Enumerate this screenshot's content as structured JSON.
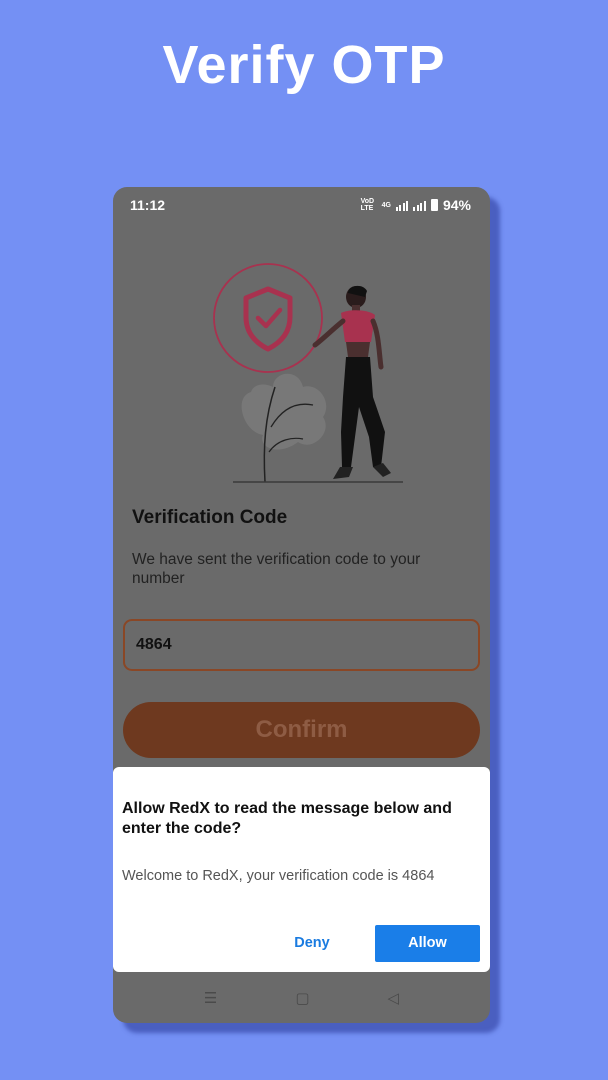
{
  "page": {
    "title": "Verify OTP"
  },
  "status_bar": {
    "time": "11:12",
    "network": "VoD LTE",
    "signal": "4G",
    "battery": "94%"
  },
  "screen": {
    "heading": "Verification Code",
    "description": "We have sent the verification code to your number",
    "otp_value": "4864",
    "confirm_label": "Confirm"
  },
  "dialog": {
    "title": "Allow RedX to read the message below and enter the code?",
    "message": "Welcome to RedX, your verification code is 4864",
    "deny_label": "Deny",
    "allow_label": "Allow"
  },
  "nav_bar": {
    "menu_icon": "☰",
    "home_icon": "▢",
    "back_icon": "◁"
  },
  "colors": {
    "background": "#7490f4",
    "accent": "#6e391f",
    "dialog_primary": "#1a7ee8",
    "illustration_accent": "#a8324f"
  }
}
